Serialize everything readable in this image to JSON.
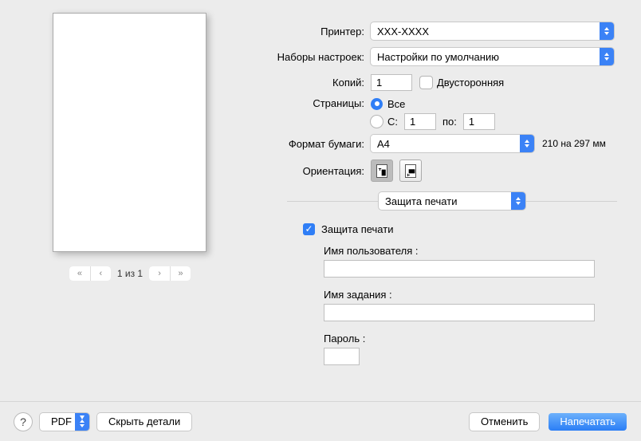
{
  "labels": {
    "printer": "Принтер:",
    "presets": "Наборы настроек:",
    "copies": "Копий:",
    "two_sided": "Двусторонняя",
    "pages": "Страницы:",
    "all": "Все",
    "from": "С:",
    "to": "по:",
    "paper_size": "Формат бумаги:",
    "paper_size_detail": "210 на 297 мм",
    "orientation": "Ориентация:",
    "section": "Защита печати",
    "secure_print": "Защита печати",
    "username": "Имя пользователя :",
    "jobname": "Имя задания :",
    "password": "Пароль :",
    "pdf": "PDF",
    "hide_details": "Скрыть детали",
    "cancel": "Отменить",
    "print": "Напечатать",
    "page_indicator": "1 из 1"
  },
  "values": {
    "printer": "XXX-XXXX",
    "presets": "Настройки по умолчанию",
    "copies": "1",
    "two_sided_checked": false,
    "pages_mode": "all",
    "pages_from": "1",
    "pages_to": "1",
    "paper_size": "A4",
    "secure_print_checked": true,
    "username": "",
    "jobname": "",
    "password": ""
  },
  "nav": {
    "first": "«",
    "prev": "‹",
    "next": "›",
    "last": "»"
  }
}
